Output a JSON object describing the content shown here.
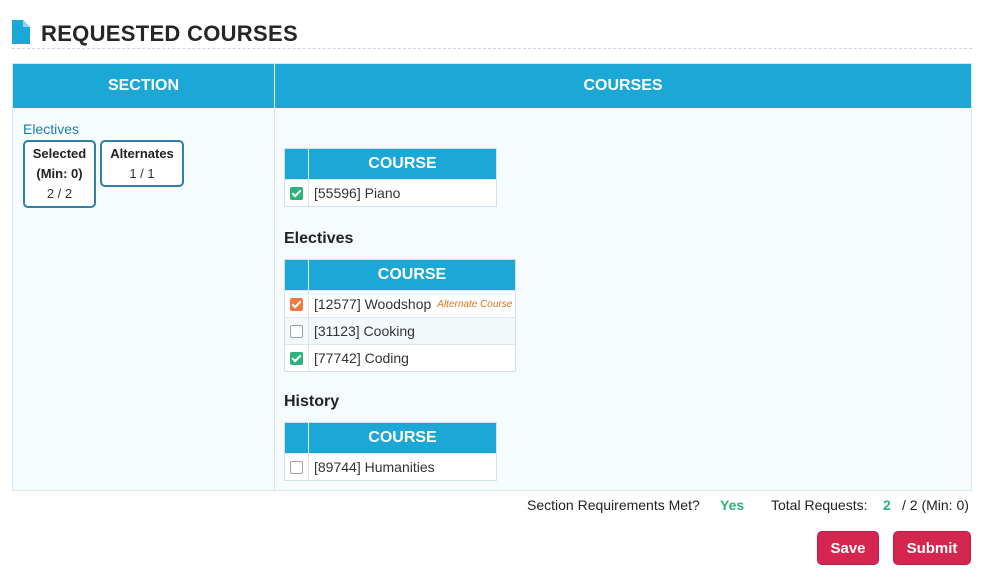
{
  "page": {
    "title": "REQUESTED COURSES"
  },
  "table": {
    "section_header": "SECTION",
    "courses_header": "COURSES"
  },
  "section": {
    "name": "Electives",
    "selected_label_1": "Selected",
    "selected_label_2": "(Min: 0)",
    "selected_value": "2 / 2",
    "alternates_label": "Alternates",
    "alternates_value": "1 / 1"
  },
  "groups": [
    {
      "title": "",
      "header": "COURSE",
      "rows": [
        {
          "text": "[55596] Piano",
          "state": "checked-green",
          "tag": ""
        }
      ]
    },
    {
      "title": "Electives",
      "header": "COURSE",
      "rows": [
        {
          "text": "[12577] Woodshop",
          "state": "checked-orange",
          "tag": "Alternate Course"
        },
        {
          "text": "[31123] Cooking",
          "state": "unchecked",
          "tag": ""
        },
        {
          "text": "[77742] Coding",
          "state": "checked-green",
          "tag": ""
        }
      ]
    },
    {
      "title": "History",
      "header": "COURSE",
      "rows": [
        {
          "text": "[89744] Humanities",
          "state": "unchecked",
          "tag": ""
        }
      ]
    }
  ],
  "footer": {
    "requirements_label": "Section Requirements Met?",
    "requirements_value": "Yes",
    "total_label": "Total Requests:",
    "total_value": "2",
    "total_suffix": "/ 2 (Min: 0)"
  },
  "buttons": {
    "save": "Save",
    "submit": "Submit"
  },
  "colors": {
    "accent": "#1ba8d6",
    "primary_button": "#d4264f",
    "success": "#2bb37a",
    "alternate": "#ef7a3d"
  }
}
